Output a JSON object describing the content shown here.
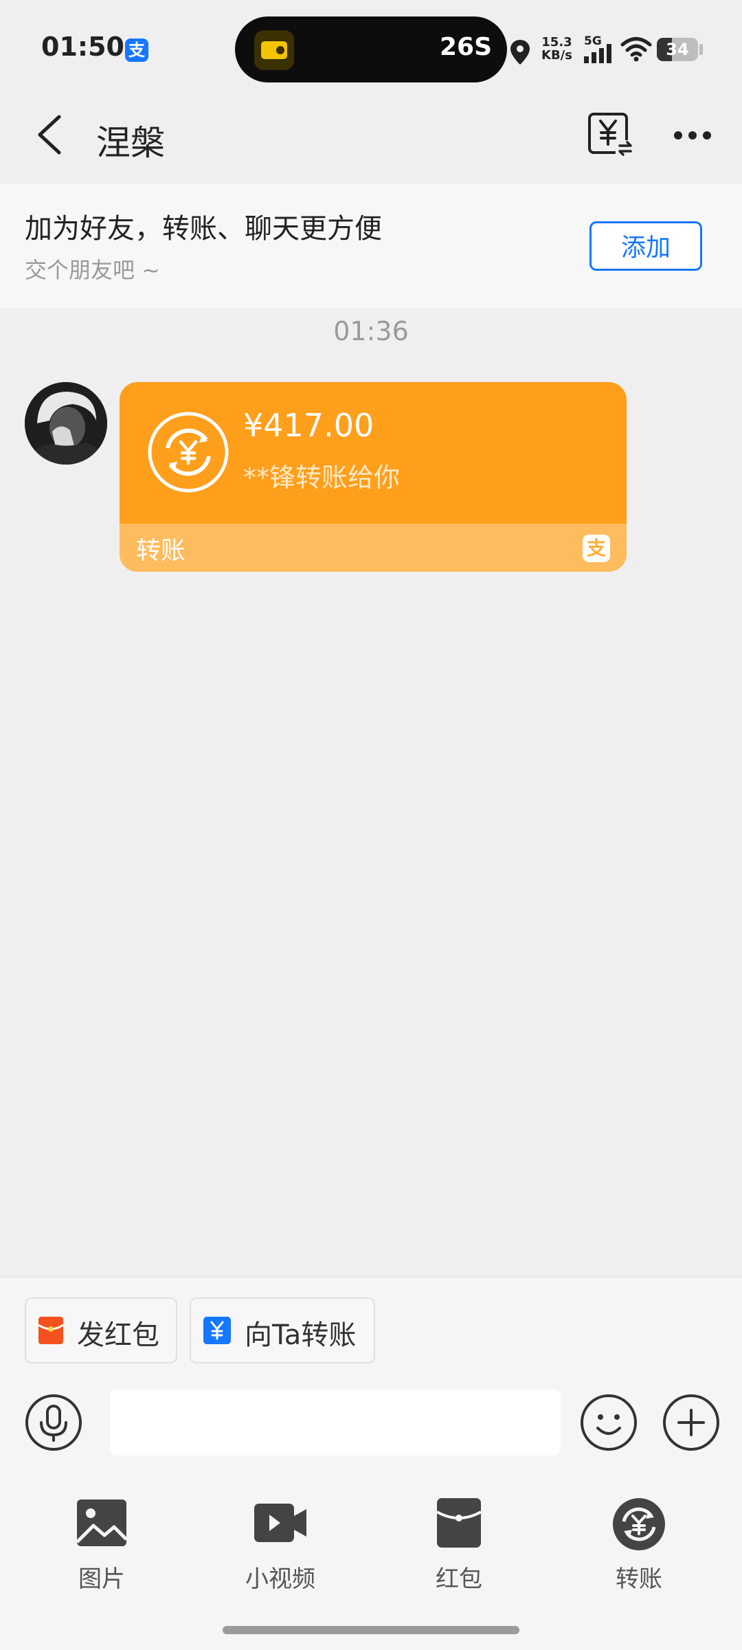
{
  "status_bar": {
    "time": "01:50",
    "app_badge": "支",
    "island_text": "26S",
    "net_speed_value": "15.3",
    "net_speed_unit": "KB/s",
    "network_type": "5G",
    "battery": "34"
  },
  "nav": {
    "title": "涅槃"
  },
  "friend_banner": {
    "title": "加为好友，转账、聊天更方便",
    "subtitle": "交个朋友吧 ~",
    "add_button": "添加"
  },
  "chat": {
    "timestamp": "01:36",
    "message": {
      "amount": "¥417.00",
      "description": "**锋转账给你",
      "type_label": "转账",
      "logo_char": "支"
    }
  },
  "quick_actions": [
    {
      "label": "发红包"
    },
    {
      "label": "向Ta转账"
    }
  ],
  "input": {
    "placeholder": ""
  },
  "tools": [
    {
      "label": "图片"
    },
    {
      "label": "小视频"
    },
    {
      "label": "红包"
    },
    {
      "label": "转账"
    }
  ],
  "colors": {
    "card_orange": "#FF9F1C",
    "card_footer": "#FFBC5E",
    "accent_blue": "#1677FF",
    "red_packet": "#F4511E"
  }
}
